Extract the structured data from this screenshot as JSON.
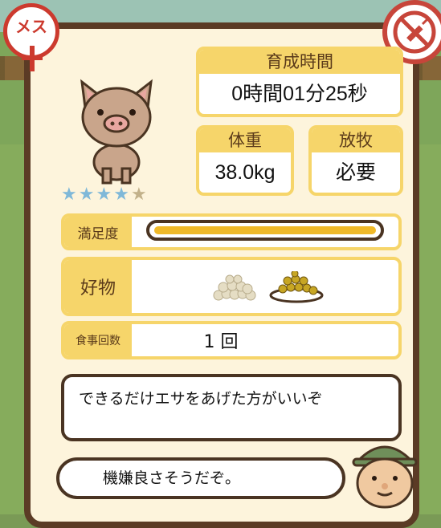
{
  "badges": {
    "gender_label": "メス",
    "gender_icon": "female-symbol-icon",
    "inject_icon": "no-injection-icon"
  },
  "rating": {
    "value": 4,
    "max": 5
  },
  "stats": {
    "growth_time_label": "育成時間",
    "growth_time_value": "0時間01分25秒",
    "weight_label": "体重",
    "weight_value": "38.0kg",
    "grazing_label": "放牧",
    "grazing_value": "必要"
  },
  "satisfaction": {
    "label": "満足度",
    "value": 1.0
  },
  "favorite": {
    "label": "好物",
    "items": [
      "grain-pile-icon",
      "soybean-plate-icon"
    ]
  },
  "meals": {
    "label": "食事回数",
    "value": "1 回"
  },
  "dialogue": {
    "bubble_top": "できるだけエサをあげた方がいいぞ",
    "bubble_bottom": "機嫌良さそうだぞ。"
  },
  "colors": {
    "accent": "#f6d56a",
    "border": "#4a3422",
    "meter": "#f0b928",
    "star_on": "#7fb8d8",
    "star_off": "#c2b18a"
  }
}
